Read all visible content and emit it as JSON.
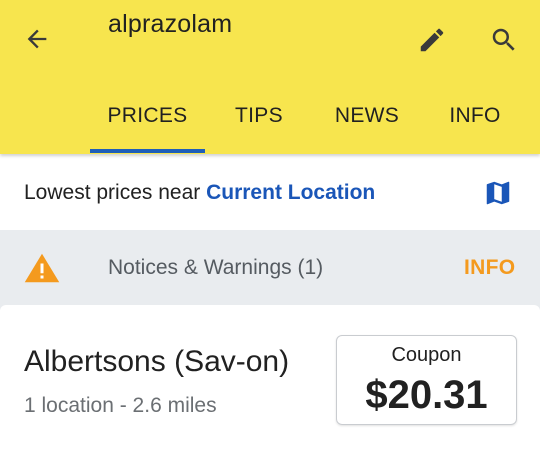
{
  "header": {
    "title": "alprazolam",
    "background": "#f7e54e",
    "icons": [
      "arrow-back-icon",
      "pencil-icon",
      "search-icon"
    ]
  },
  "tabs": [
    {
      "label": "PRICES",
      "selected": true
    },
    {
      "label": "TIPS",
      "selected": false
    },
    {
      "label": "NEWS",
      "selected": false
    },
    {
      "label": "INFO",
      "selected": false
    }
  ],
  "accent_color": "#1f5fb8",
  "location": {
    "prefix": "Lowest prices near ",
    "link": "Current Location",
    "icon": "map-icon"
  },
  "notice": {
    "icon": "warning-icon",
    "text": "Notices & Warnings (1)",
    "action": "INFO",
    "action_color": "#f49a1e"
  },
  "pharmacy": {
    "name": "Albertsons (Sav-on)",
    "meta": "1 location - 2.6 miles",
    "price_label": "Coupon",
    "price": "$20.31"
  }
}
